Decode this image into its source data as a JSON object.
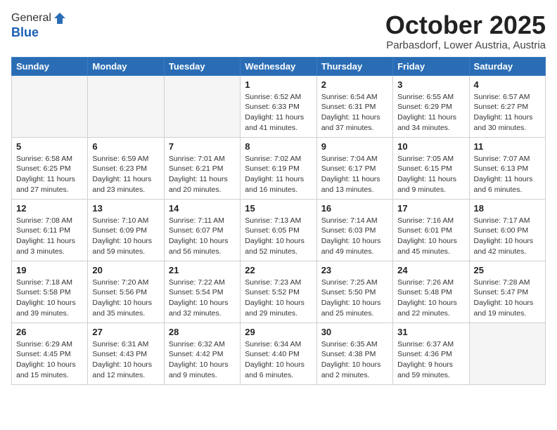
{
  "logo": {
    "general": "General",
    "blue": "Blue"
  },
  "header": {
    "month": "October 2025",
    "location": "Parbasdorf, Lower Austria, Austria"
  },
  "weekdays": [
    "Sunday",
    "Monday",
    "Tuesday",
    "Wednesday",
    "Thursday",
    "Friday",
    "Saturday"
  ],
  "weeks": [
    [
      {
        "day": "",
        "info": ""
      },
      {
        "day": "",
        "info": ""
      },
      {
        "day": "",
        "info": ""
      },
      {
        "day": "1",
        "info": "Sunrise: 6:52 AM\nSunset: 6:33 PM\nDaylight: 11 hours\nand 41 minutes."
      },
      {
        "day": "2",
        "info": "Sunrise: 6:54 AM\nSunset: 6:31 PM\nDaylight: 11 hours\nand 37 minutes."
      },
      {
        "day": "3",
        "info": "Sunrise: 6:55 AM\nSunset: 6:29 PM\nDaylight: 11 hours\nand 34 minutes."
      },
      {
        "day": "4",
        "info": "Sunrise: 6:57 AM\nSunset: 6:27 PM\nDaylight: 11 hours\nand 30 minutes."
      }
    ],
    [
      {
        "day": "5",
        "info": "Sunrise: 6:58 AM\nSunset: 6:25 PM\nDaylight: 11 hours\nand 27 minutes."
      },
      {
        "day": "6",
        "info": "Sunrise: 6:59 AM\nSunset: 6:23 PM\nDaylight: 11 hours\nand 23 minutes."
      },
      {
        "day": "7",
        "info": "Sunrise: 7:01 AM\nSunset: 6:21 PM\nDaylight: 11 hours\nand 20 minutes."
      },
      {
        "day": "8",
        "info": "Sunrise: 7:02 AM\nSunset: 6:19 PM\nDaylight: 11 hours\nand 16 minutes."
      },
      {
        "day": "9",
        "info": "Sunrise: 7:04 AM\nSunset: 6:17 PM\nDaylight: 11 hours\nand 13 minutes."
      },
      {
        "day": "10",
        "info": "Sunrise: 7:05 AM\nSunset: 6:15 PM\nDaylight: 11 hours\nand 9 minutes."
      },
      {
        "day": "11",
        "info": "Sunrise: 7:07 AM\nSunset: 6:13 PM\nDaylight: 11 hours\nand 6 minutes."
      }
    ],
    [
      {
        "day": "12",
        "info": "Sunrise: 7:08 AM\nSunset: 6:11 PM\nDaylight: 11 hours\nand 3 minutes."
      },
      {
        "day": "13",
        "info": "Sunrise: 7:10 AM\nSunset: 6:09 PM\nDaylight: 10 hours\nand 59 minutes."
      },
      {
        "day": "14",
        "info": "Sunrise: 7:11 AM\nSunset: 6:07 PM\nDaylight: 10 hours\nand 56 minutes."
      },
      {
        "day": "15",
        "info": "Sunrise: 7:13 AM\nSunset: 6:05 PM\nDaylight: 10 hours\nand 52 minutes."
      },
      {
        "day": "16",
        "info": "Sunrise: 7:14 AM\nSunset: 6:03 PM\nDaylight: 10 hours\nand 49 minutes."
      },
      {
        "day": "17",
        "info": "Sunrise: 7:16 AM\nSunset: 6:01 PM\nDaylight: 10 hours\nand 45 minutes."
      },
      {
        "day": "18",
        "info": "Sunrise: 7:17 AM\nSunset: 6:00 PM\nDaylight: 10 hours\nand 42 minutes."
      }
    ],
    [
      {
        "day": "19",
        "info": "Sunrise: 7:18 AM\nSunset: 5:58 PM\nDaylight: 10 hours\nand 39 minutes."
      },
      {
        "day": "20",
        "info": "Sunrise: 7:20 AM\nSunset: 5:56 PM\nDaylight: 10 hours\nand 35 minutes."
      },
      {
        "day": "21",
        "info": "Sunrise: 7:22 AM\nSunset: 5:54 PM\nDaylight: 10 hours\nand 32 minutes."
      },
      {
        "day": "22",
        "info": "Sunrise: 7:23 AM\nSunset: 5:52 PM\nDaylight: 10 hours\nand 29 minutes."
      },
      {
        "day": "23",
        "info": "Sunrise: 7:25 AM\nSunset: 5:50 PM\nDaylight: 10 hours\nand 25 minutes."
      },
      {
        "day": "24",
        "info": "Sunrise: 7:26 AM\nSunset: 5:48 PM\nDaylight: 10 hours\nand 22 minutes."
      },
      {
        "day": "25",
        "info": "Sunrise: 7:28 AM\nSunset: 5:47 PM\nDaylight: 10 hours\nand 19 minutes."
      }
    ],
    [
      {
        "day": "26",
        "info": "Sunrise: 6:29 AM\nSunset: 4:45 PM\nDaylight: 10 hours\nand 15 minutes."
      },
      {
        "day": "27",
        "info": "Sunrise: 6:31 AM\nSunset: 4:43 PM\nDaylight: 10 hours\nand 12 minutes."
      },
      {
        "day": "28",
        "info": "Sunrise: 6:32 AM\nSunset: 4:42 PM\nDaylight: 10 hours\nand 9 minutes."
      },
      {
        "day": "29",
        "info": "Sunrise: 6:34 AM\nSunset: 4:40 PM\nDaylight: 10 hours\nand 6 minutes."
      },
      {
        "day": "30",
        "info": "Sunrise: 6:35 AM\nSunset: 4:38 PM\nDaylight: 10 hours\nand 2 minutes."
      },
      {
        "day": "31",
        "info": "Sunrise: 6:37 AM\nSunset: 4:36 PM\nDaylight: 9 hours\nand 59 minutes."
      },
      {
        "day": "",
        "info": ""
      }
    ]
  ]
}
